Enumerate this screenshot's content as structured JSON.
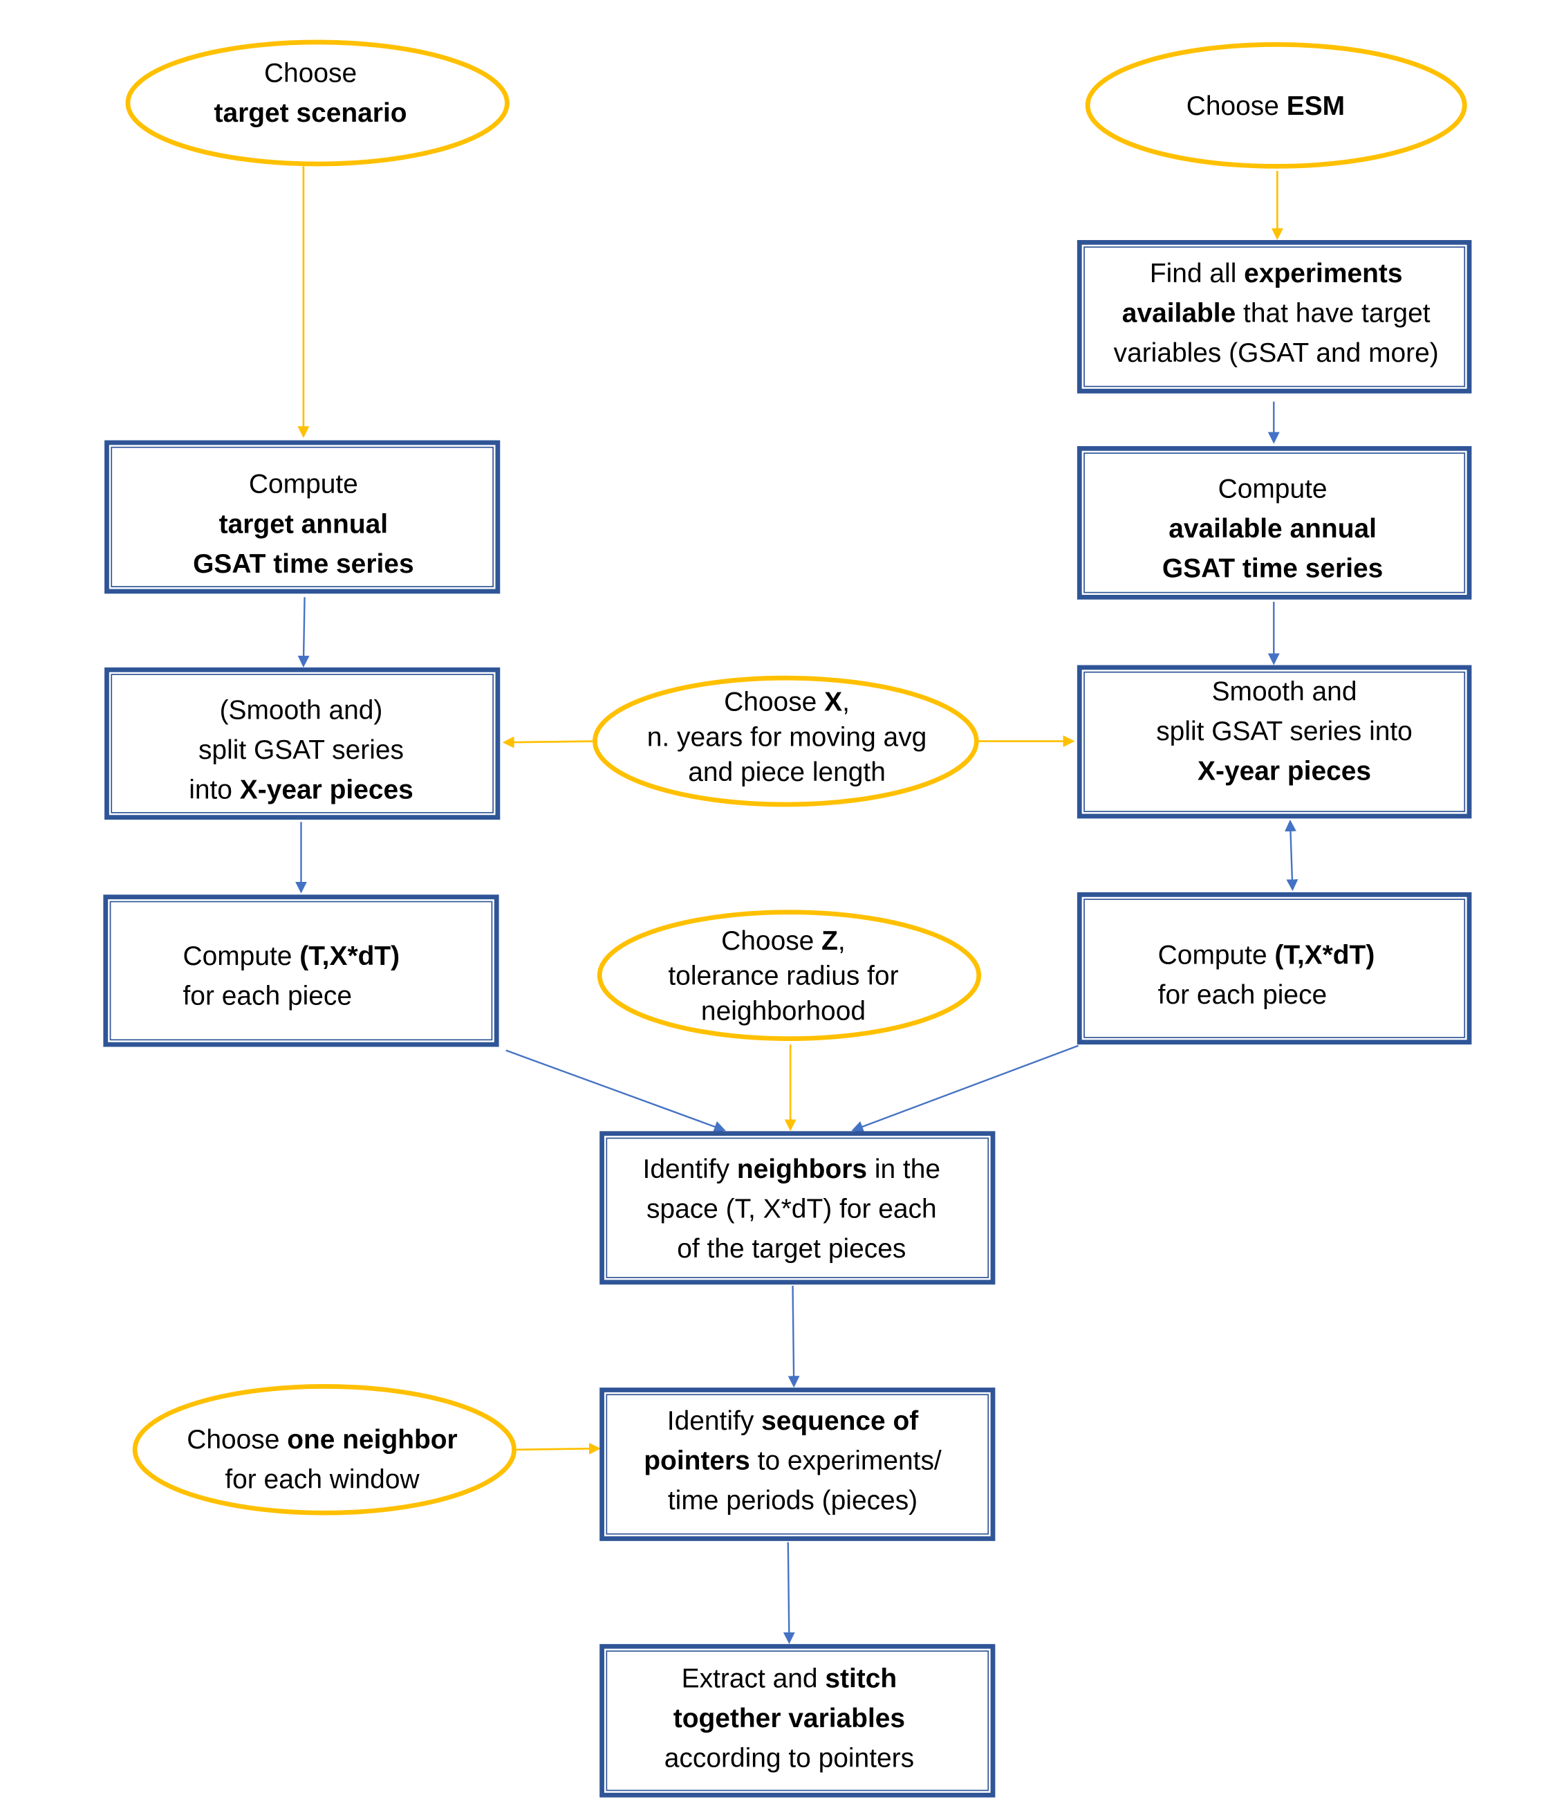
{
  "colors": {
    "ellipse_stroke": "#FFC000",
    "box_stroke": "#2F5597",
    "blue_arrow": "#4472C4",
    "yellow_arrow": "#FFC000"
  },
  "nodes": {
    "choose_target_scenario": {
      "lines": [
        [
          {
            "t": "Choose",
            "b": false
          }
        ],
        [
          {
            "t": "target scenario",
            "b": true
          }
        ]
      ]
    },
    "choose_esm": {
      "lines": [
        [
          {
            "t": "Choose ",
            "b": false
          },
          {
            "t": "ESM",
            "b": true
          }
        ]
      ]
    },
    "find_experiments": {
      "lines": [
        [
          {
            "t": "Find all ",
            "b": false
          },
          {
            "t": "experiments",
            "b": true
          }
        ],
        [
          {
            "t": "available",
            "b": true
          },
          {
            "t": " that have target",
            "b": false
          }
        ],
        [
          {
            "t": "variables (GSAT and more)",
            "b": false
          }
        ]
      ]
    },
    "compute_target_gsat": {
      "lines": [
        [
          {
            "t": "Compute",
            "b": false
          }
        ],
        [
          {
            "t": "target annual",
            "b": true
          }
        ],
        [
          {
            "t": "GSAT time series",
            "b": true
          }
        ]
      ]
    },
    "compute_available_gsat": {
      "lines": [
        [
          {
            "t": "Compute",
            "b": false
          }
        ],
        [
          {
            "t": "available annual",
            "b": true
          }
        ],
        [
          {
            "t": "GSAT time series",
            "b": true
          }
        ]
      ]
    },
    "split_target": {
      "lines": [
        [
          {
            "t": "(Smooth and)",
            "b": false
          }
        ],
        [
          {
            "t": "split GSAT series",
            "b": false
          }
        ],
        [
          {
            "t": "into ",
            "b": false
          },
          {
            "t": "X-year pieces",
            "b": true
          }
        ]
      ]
    },
    "choose_x": {
      "lines": [
        [
          {
            "t": "Choose ",
            "b": false
          },
          {
            "t": "X",
            "b": true
          },
          {
            "t": ",",
            "b": false
          }
        ],
        [
          {
            "t": "n. years for moving avg",
            "b": false
          }
        ],
        [
          {
            "t": "and piece length",
            "b": false
          }
        ]
      ]
    },
    "split_available": {
      "lines": [
        [
          {
            "t": "Smooth and",
            "b": false
          }
        ],
        [
          {
            "t": "split  GSAT series into",
            "b": false
          }
        ],
        [
          {
            "t": "X-year pieces",
            "b": true
          }
        ]
      ]
    },
    "compute_t_target": {
      "lines": [
        [
          {
            "t": "Compute ",
            "b": false
          },
          {
            "t": "(T,X*dT)",
            "b": true
          }
        ],
        [
          {
            "t": "for each piece",
            "b": false
          }
        ]
      ]
    },
    "choose_z": {
      "lines": [
        [
          {
            "t": "Choose ",
            "b": false
          },
          {
            "t": "Z",
            "b": true
          },
          {
            "t": ",",
            "b": false
          }
        ],
        [
          {
            "t": "tolerance radius for",
            "b": false
          }
        ],
        [
          {
            "t": "neighborhood",
            "b": false
          }
        ]
      ]
    },
    "compute_t_available": {
      "lines": [
        [
          {
            "t": "Compute ",
            "b": false
          },
          {
            "t": "(T,X*dT)",
            "b": true
          }
        ],
        [
          {
            "t": "for each piece",
            "b": false
          }
        ]
      ]
    },
    "identify_neighbors": {
      "lines": [
        [
          {
            "t": "Identify ",
            "b": false
          },
          {
            "t": "neighbors",
            "b": true
          },
          {
            "t": " in the",
            "b": false
          }
        ],
        [
          {
            "t": "space  (T, X*dT) for each",
            "b": false
          }
        ],
        [
          {
            "t": "of the target pieces",
            "b": false
          }
        ]
      ]
    },
    "choose_one_neighbor": {
      "lines": [
        [
          {
            "t": "Choose ",
            "b": false
          },
          {
            "t": "one neighbor",
            "b": true
          }
        ],
        [
          {
            "t": "for each window",
            "b": false
          }
        ]
      ]
    },
    "identify_sequence": {
      "lines": [
        [
          {
            "t": "Identify ",
            "b": false
          },
          {
            "t": "sequence of",
            "b": true
          }
        ],
        [
          {
            "t": "pointers",
            "b": true
          },
          {
            "t": " to experiments/",
            "b": false
          }
        ],
        [
          {
            "t": "time periods (pieces)",
            "b": false
          }
        ]
      ]
    },
    "extract_stitch": {
      "lines": [
        [
          {
            "t": "Extract and ",
            "b": false
          },
          {
            "t": "stitch",
            "b": true
          }
        ],
        [
          {
            "t": "together variables",
            "b": true
          }
        ],
        [
          {
            "t": "according to pointers",
            "b": false
          }
        ]
      ]
    }
  }
}
